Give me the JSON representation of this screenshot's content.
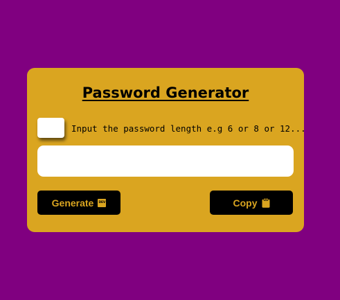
{
  "app": {
    "title": "Password Generator"
  },
  "length_input": {
    "value": "",
    "label": "Input the password length e.g 6 or 8 or 12..."
  },
  "output": {
    "value": ""
  },
  "buttons": {
    "generate_label": "Generate",
    "generate_icon": "dev-badge-icon",
    "dev_icon_text": "DEV",
    "copy_label": "Copy",
    "copy_icon": "clipboard-icon"
  },
  "colors": {
    "page_background": "#800080",
    "card_background": "#daa520",
    "button_background": "#000000",
    "button_text": "#daa520"
  }
}
